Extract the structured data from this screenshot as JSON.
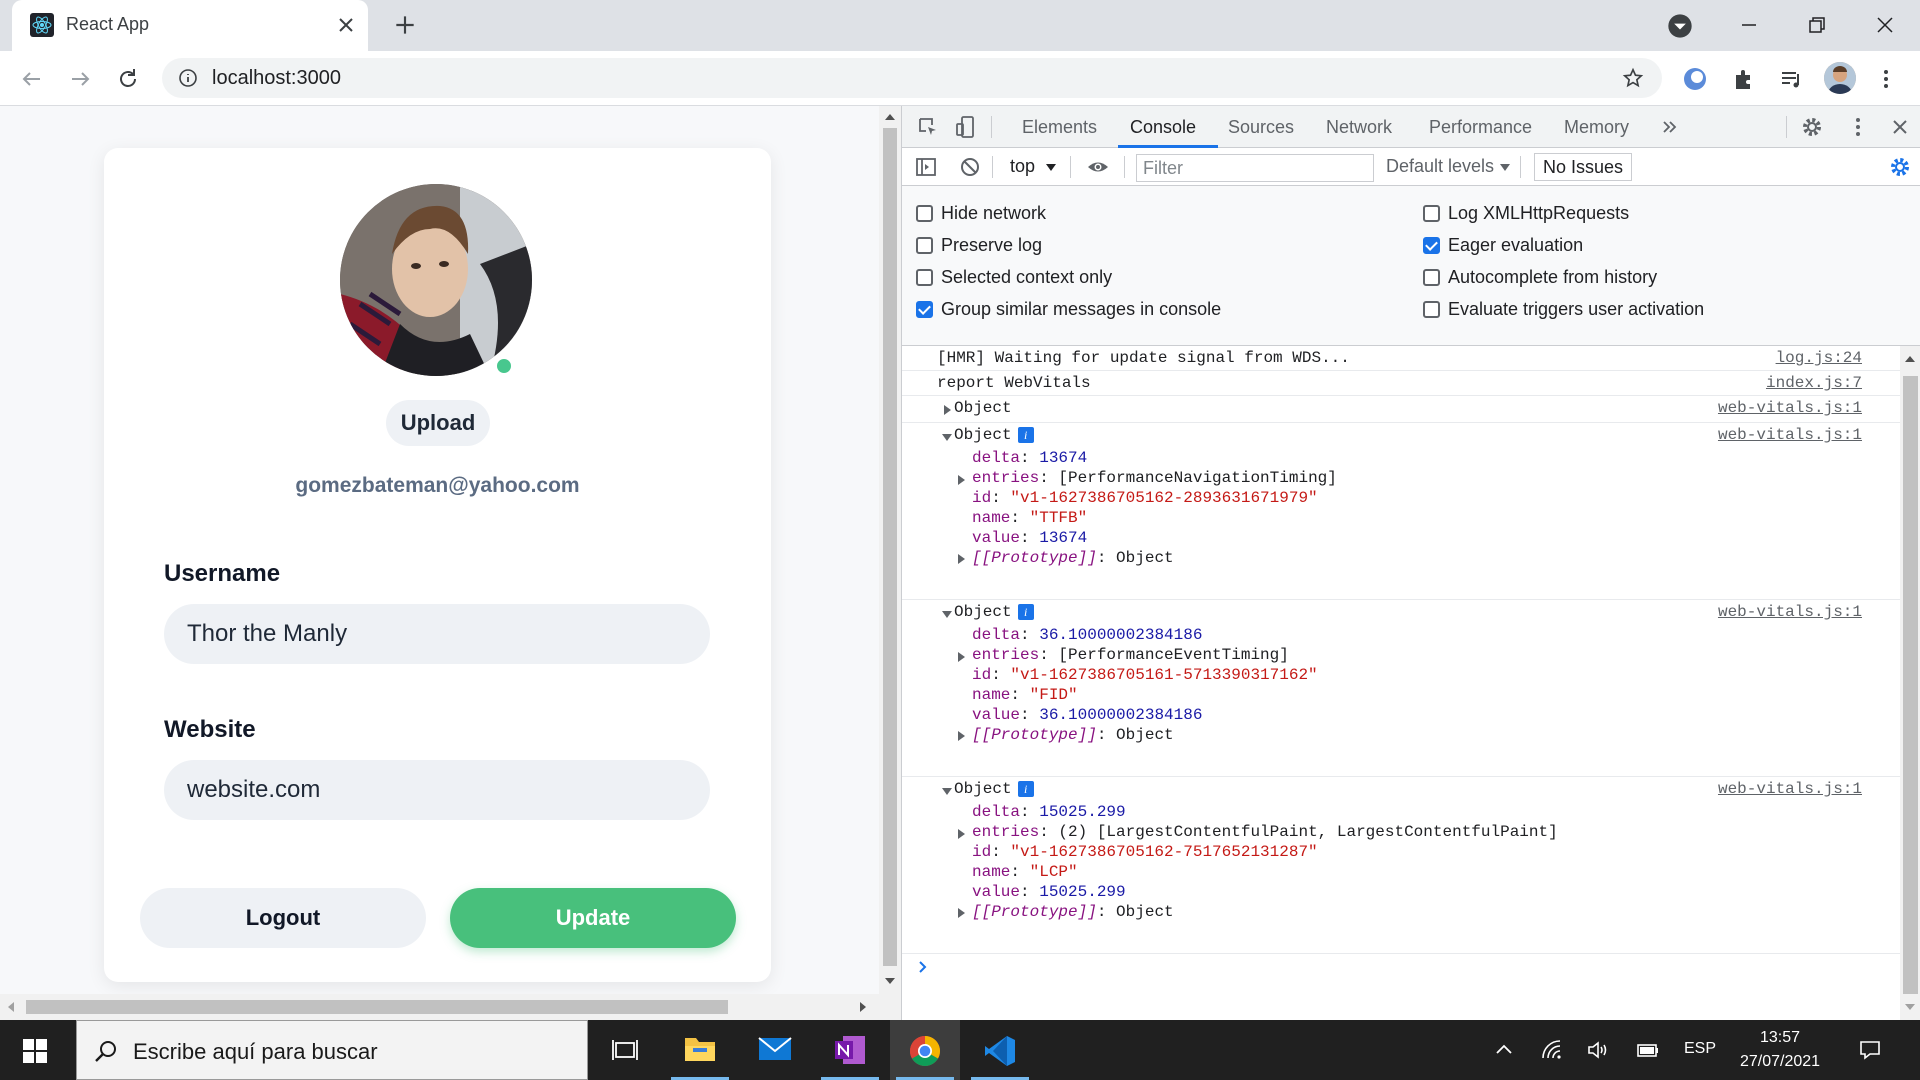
{
  "browser": {
    "tab_title": "React App",
    "url": "localhost:3000"
  },
  "page": {
    "email": "gomezbateman@yahoo.com",
    "upload_label": "Upload",
    "username_label": "Username",
    "username_value": "Thor the Manly",
    "website_label": "Website",
    "website_value": "website.com",
    "logout_label": "Logout",
    "update_label": "Update",
    "accent_color": "#48c07c"
  },
  "devtools": {
    "tabs": [
      "Elements",
      "Console",
      "Sources",
      "Network",
      "Performance",
      "Memory"
    ],
    "active_tab": "Console",
    "context": "top",
    "filter_placeholder": "Filter",
    "levels": "Default levels",
    "issues": "No Issues",
    "settings_left": [
      {
        "label": "Hide network",
        "checked": false
      },
      {
        "label": "Preserve log",
        "checked": false
      },
      {
        "label": "Selected context only",
        "checked": false
      },
      {
        "label": "Group similar messages in console",
        "checked": true
      }
    ],
    "settings_right": [
      {
        "label": "Log XMLHttpRequests",
        "checked": false
      },
      {
        "label": "Eager evaluation",
        "checked": true
      },
      {
        "label": "Autocomplete from history",
        "checked": false
      },
      {
        "label": "Evaluate triggers user activation",
        "checked": false
      }
    ],
    "console": {
      "msg1": "[HMR] Waiting for update signal from WDS...",
      "src1": "log.js:24",
      "msg2": "report WebVitals",
      "src2": "index.js:7",
      "obj_label": "Object",
      "vitals_src": "web-vitals.js:1",
      "proto": "[[Prototype]]",
      "proto_val": "Object",
      "entries": [
        {
          "delta": "13674",
          "entries": "[PerformanceNavigationTiming]",
          "id": "\"v1-1627386705162-2893631671979\"",
          "name": "\"TTFB\"",
          "value": "13674"
        },
        {
          "delta": "36.10000002384186",
          "entries": "[PerformanceEventTiming]",
          "id": "\"v1-1627386705161-5713390317162\"",
          "name": "\"FID\"",
          "value": "36.10000002384186"
        },
        {
          "delta": "15025.299",
          "entries": "(2) [LargestContentfulPaint, LargestContentfulPaint]",
          "id": "\"v1-1627386705162-7517652131287\"",
          "name": "\"LCP\"",
          "value": "15025.299"
        }
      ]
    }
  },
  "taskbar": {
    "search_placeholder": "Escribe aquí para buscar",
    "lang": "ESP",
    "time": "13:57",
    "date": "27/07/2021"
  }
}
